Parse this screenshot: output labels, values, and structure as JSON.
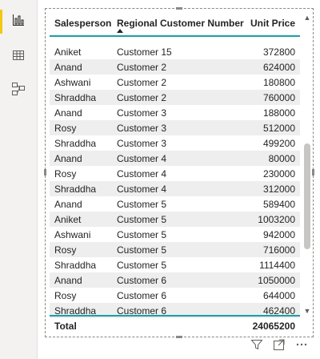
{
  "rail": {
    "items": [
      {
        "name": "report-view",
        "active": true
      },
      {
        "name": "data-view",
        "active": false
      },
      {
        "name": "model-view",
        "active": false
      }
    ]
  },
  "table": {
    "columns": [
      "Salesperson",
      "Regional Customer Number",
      "Unit Price"
    ],
    "sorted_column": "Regional Customer Number",
    "rows": [
      [
        "Aniket",
        "Customer 15",
        "372800"
      ],
      [
        "Anand",
        "Customer 2",
        "624000"
      ],
      [
        "Ashwani",
        "Customer 2",
        "180800"
      ],
      [
        "Shraddha",
        "Customer 2",
        "760000"
      ],
      [
        "Anand",
        "Customer 3",
        "188000"
      ],
      [
        "Rosy",
        "Customer 3",
        "512000"
      ],
      [
        "Shraddha",
        "Customer 3",
        "499200"
      ],
      [
        "Anand",
        "Customer 4",
        "80000"
      ],
      [
        "Rosy",
        "Customer 4",
        "230000"
      ],
      [
        "Shraddha",
        "Customer 4",
        "312000"
      ],
      [
        "Anand",
        "Customer 5",
        "589400"
      ],
      [
        "Aniket",
        "Customer 5",
        "1003200"
      ],
      [
        "Ashwani",
        "Customer 5",
        "942000"
      ],
      [
        "Rosy",
        "Customer 5",
        "716000"
      ],
      [
        "Shraddha",
        "Customer 5",
        "1114400"
      ],
      [
        "Anand",
        "Customer 6",
        "1050000"
      ],
      [
        "Rosy",
        "Customer 6",
        "644000"
      ],
      [
        "Shraddha",
        "Customer 6",
        "462400"
      ]
    ],
    "total_label": "Total",
    "total_value": "24065200"
  },
  "colors": {
    "accent": "#1b9fa7",
    "rail_active": "#f2c811",
    "alt_row": "#eeeeee"
  },
  "footer": {
    "icons": [
      "filter-icon",
      "focus-mode-icon",
      "more-options-icon"
    ]
  }
}
